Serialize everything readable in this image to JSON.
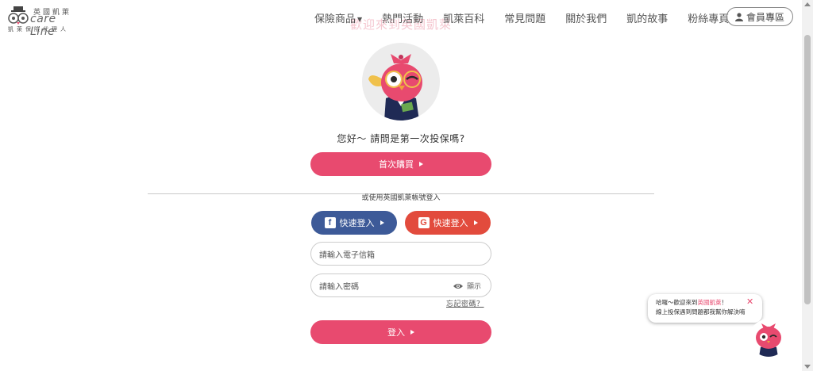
{
  "header": {
    "logo": {
      "cn_top": "英國凱萊",
      "en": "care Line",
      "cn_bottom": "凱萊保險代理人"
    },
    "nav": [
      {
        "label": "保險商品",
        "has_caret": true
      },
      {
        "label": "熱門活動"
      },
      {
        "label": "凱萊百科"
      },
      {
        "label": "常見問題"
      },
      {
        "label": "關於我們"
      },
      {
        "label": "凱的故事"
      },
      {
        "label": "粉絲專頁"
      }
    ],
    "member_label": "會員專區",
    "ghost_title": "歡迎來到英國凱萊"
  },
  "main": {
    "greeting": "您好～ 請問是第一次投保嗎?",
    "first_buy_label": "首次購買",
    "divider_text": "或使用英國凱萊帳號登入",
    "facebook_label": "快速登入",
    "google_label": "快速登入",
    "email_placeholder": "請輸入電子信箱",
    "password_placeholder": "請輸入密碼",
    "show_password_label": "顯示",
    "forgot_label": "忘記密碼？",
    "login_label": "登入"
  },
  "chat": {
    "line1_prefix": "哈囉～歡迎來到",
    "line1_highlight": "英國凱萊",
    "line1_suffix": "！",
    "line2": "線上投保遇到問題都我幫你解決唷",
    "close_symbol": "✕"
  },
  "colors": {
    "primary": "#e84a6f",
    "facebook": "#3d5a98",
    "google": "#e24b3d"
  }
}
